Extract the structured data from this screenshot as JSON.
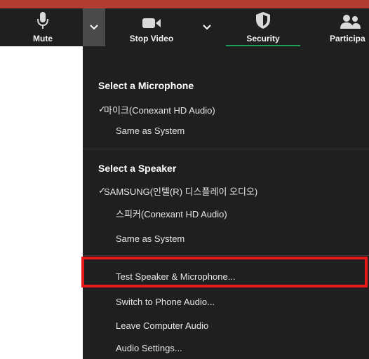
{
  "toolbar": {
    "mute_label": "Mute",
    "stop_video_label": "Stop Video",
    "security_label": "Security",
    "participants_label": "Participa",
    "accent_color": "#1fa05a"
  },
  "menu": {
    "microphone_title": "Select a Microphone",
    "microphone_items": [
      {
        "label": "마이크(Conexant HD Audio)",
        "checked": true
      },
      {
        "label": "Same as System",
        "checked": false
      }
    ],
    "speaker_title": "Select a Speaker",
    "speaker_items": [
      {
        "label": "SAMSUNG(인텔(R) 디스플레이 오디오)",
        "checked": true
      },
      {
        "label": "스피커(Conexant HD Audio)",
        "checked": false
      },
      {
        "label": "Same as System",
        "checked": false
      }
    ],
    "actions": [
      {
        "label": "Test Speaker & Microphone..."
      },
      {
        "label": "Switch to Phone Audio..."
      },
      {
        "label": "Leave Computer Audio"
      },
      {
        "label": "Audio Settings..."
      }
    ],
    "check_glyph": "✓"
  },
  "highlight_color": "#e8181a"
}
